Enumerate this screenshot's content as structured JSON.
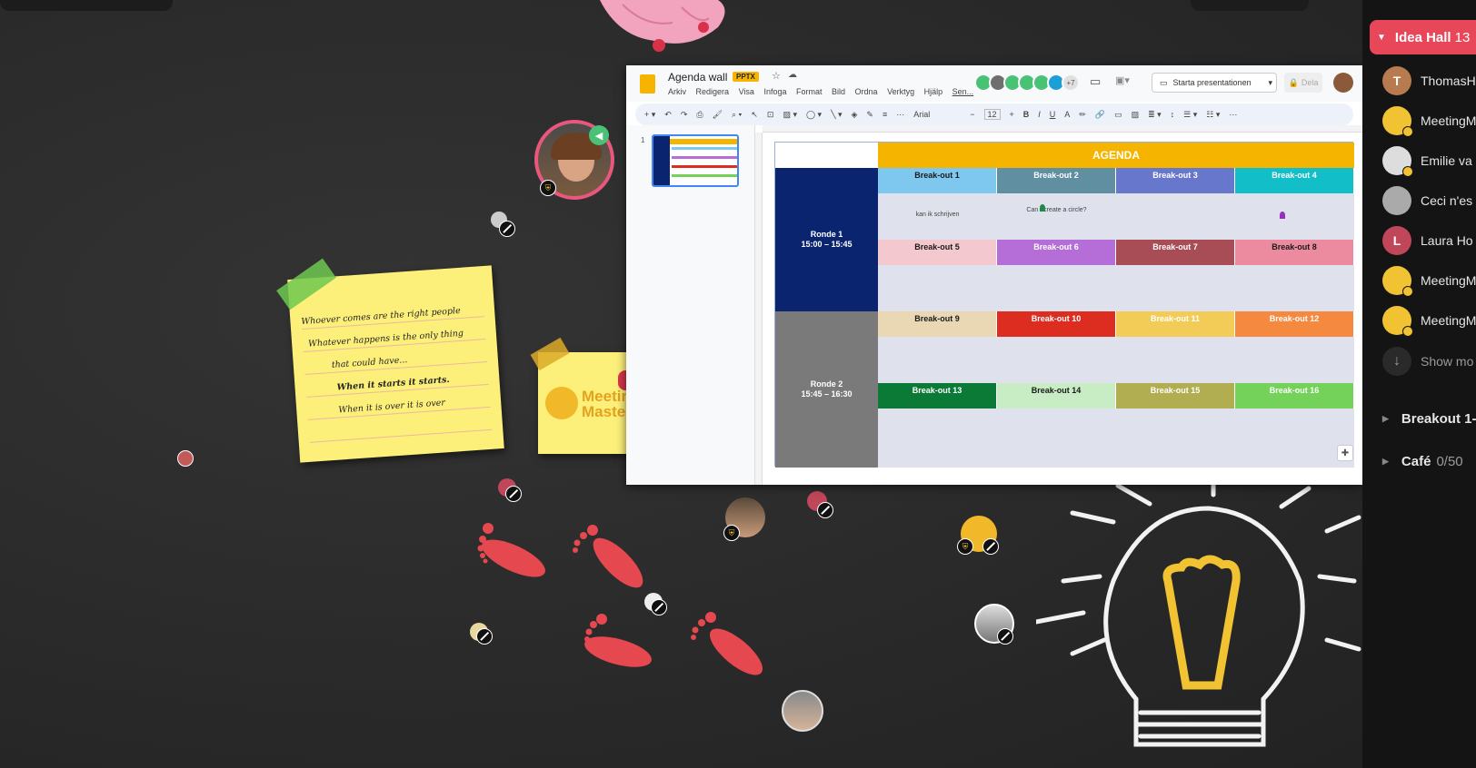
{
  "colors": {
    "room_header": "#e8475a",
    "canvas_bg": "#2a2a2a",
    "sticky_yellow": "#fdf07a",
    "footprint": "#e5494f",
    "bulb_yellow": "#f1c232"
  },
  "sidebar": {
    "room": {
      "name": "Idea Hall",
      "count": "13"
    },
    "participants": [
      {
        "name": "ThomasH",
        "initial": "T",
        "color": "#b87b4f",
        "badge": false
      },
      {
        "name": "MeetingM",
        "initial": "",
        "color": "#f1c232",
        "badge": true,
        "icon": "meetingmasters-logo-icon"
      },
      {
        "name": "Emilie va",
        "initial": "",
        "color": "#ddd",
        "badge": true
      },
      {
        "name": "Ceci n'es",
        "initial": "",
        "color": "#aaa",
        "badge": false
      },
      {
        "name": "Laura Ho",
        "initial": "L",
        "color": "#c0465a",
        "badge": false
      },
      {
        "name": "MeetingM",
        "initial": "",
        "color": "#f1c232",
        "badge": true,
        "icon": "meetingmasters-logo-icon"
      },
      {
        "name": "MeetingM",
        "initial": "",
        "color": "#f1c232",
        "badge": true,
        "icon": "meetingmasters-logo-icon"
      }
    ],
    "show_more": "Show mo",
    "sections": [
      {
        "name": "Breakout 1-",
        "count": ""
      },
      {
        "name": "Café",
        "count": "0/50"
      }
    ]
  },
  "slides": {
    "title": "Agenda wall",
    "badge": "PPTX",
    "menu": [
      "Arkiv",
      "Redigera",
      "Visa",
      "Infoga",
      "Format",
      "Bild",
      "Ordna",
      "Verktyg",
      "Hjälp",
      "Sen..."
    ],
    "collab_more": "+7",
    "present_label": "Starta presentationen",
    "share_label": "Dela",
    "font_name": "Arial",
    "font_size": "12",
    "slide_number": "1",
    "agenda": {
      "title": "AGENDA",
      "rounds": [
        {
          "label": "Ronde 1",
          "time": "15:00 – 15:45"
        },
        {
          "label": "Ronde 2",
          "time": "15:45 – 16:30"
        }
      ],
      "breakouts": [
        {
          "label": "Break-out 1",
          "color": "#7ec8ef",
          "text_color": "#1a1a1a"
        },
        {
          "label": "Break-out 2",
          "color": "#5f8fa0",
          "text_color": "#ffffff"
        },
        {
          "label": "Break-out 3",
          "color": "#6677cc",
          "text_color": "#ffffff"
        },
        {
          "label": "Break-out 4",
          "color": "#12bfc9",
          "text_color": "#ffffff"
        },
        {
          "label": "Break-out 5",
          "color": "#f4c8cf",
          "text_color": "#1a1a1a"
        },
        {
          "label": "Break-out 6",
          "color": "#b56ed8",
          "text_color": "#ffffff"
        },
        {
          "label": "Break-out 7",
          "color": "#a84c55",
          "text_color": "#ffffff"
        },
        {
          "label": "Break-out 8",
          "color": "#ec8aa0",
          "text_color": "#1a1a1a"
        },
        {
          "label": "Break-out 9",
          "color": "#ead8b4",
          "text_color": "#1a1a1a"
        },
        {
          "label": "Break-out 10",
          "color": "#dd2d20",
          "text_color": "#ffffff"
        },
        {
          "label": "Break-out 11",
          "color": "#f3cc58",
          "text_color": "#ffffff"
        },
        {
          "label": "Break-out 12",
          "color": "#f4893f",
          "text_color": "#ffffff"
        },
        {
          "label": "Break-out 13",
          "color": "#0a7a36",
          "text_color": "#ffffff"
        },
        {
          "label": "Break-out 14",
          "color": "#c8ecc4",
          "text_color": "#1a1a1a"
        },
        {
          "label": "Break-out 15",
          "color": "#b0ae50",
          "text_color": "#ffffff"
        },
        {
          "label": "Break-out 16",
          "color": "#74d25a",
          "text_color": "#ffffff"
        }
      ],
      "notes": [
        {
          "text": "kan ik schrijven",
          "cell": 0
        },
        {
          "text": "Can I create a circle?",
          "cell": 1
        }
      ]
    }
  },
  "stickies": [
    {
      "lines": [
        "Whoever comes are the right people",
        "Whatever happens is the only thing",
        "that could have...",
        "When it starts it starts.",
        "When it is over it is over"
      ]
    },
    {
      "logo_text": [
        "Meetin",
        "Master"
      ]
    }
  ]
}
